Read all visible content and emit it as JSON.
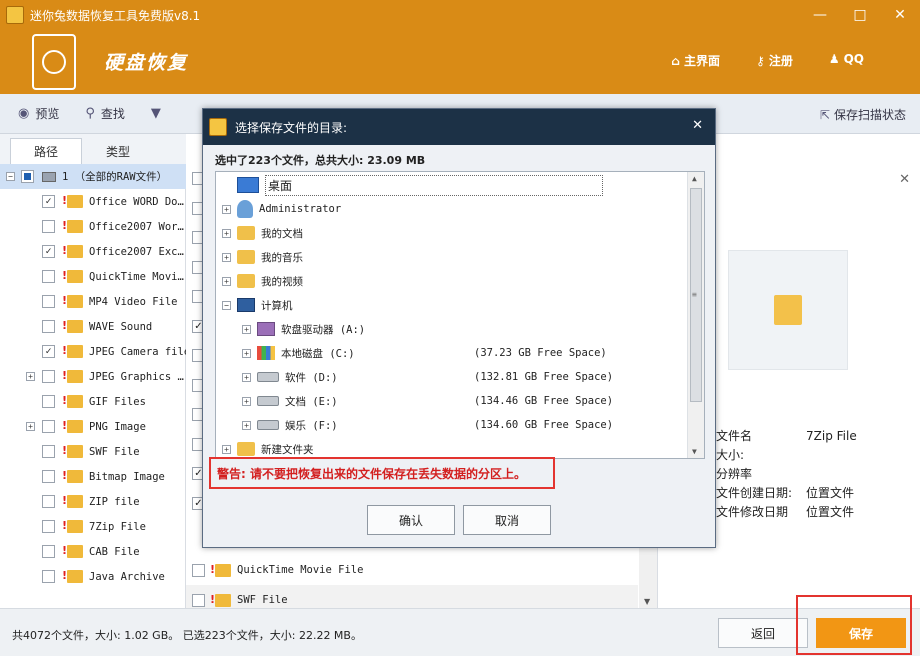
{
  "window": {
    "title": "迷你兔数据恢复工具免费版v8.1",
    "controls": [
      "—",
      "□",
      "✕"
    ]
  },
  "header": {
    "brand": "硬盘恢复",
    "nav": [
      {
        "icon": "home-icon",
        "glyph": "⌂",
        "label": "主界面"
      },
      {
        "icon": "key-icon",
        "glyph": "⚷",
        "label": "注册"
      },
      {
        "icon": "qq-icon",
        "glyph": "♟",
        "label": "QQ"
      }
    ]
  },
  "toolbar": {
    "preview_label": "预览",
    "search_label": "查找",
    "save_scan_label": "保存扫描状态"
  },
  "tabs": [
    "路径",
    "类型"
  ],
  "tree": {
    "root_label": "1 （全部的RAW文件）",
    "items": [
      {
        "label": "Office WORD Do…",
        "checked": true
      },
      {
        "label": "Office2007 Wor…",
        "checked": false
      },
      {
        "label": "Office2007 Exc…",
        "checked": true
      },
      {
        "label": "QuickTime Movi…",
        "checked": false
      },
      {
        "label": "MP4 Video File",
        "checked": false
      },
      {
        "label": "WAVE Sound",
        "checked": false
      },
      {
        "label": "JPEG Camera file",
        "checked": true
      },
      {
        "label": "JPEG Graphics …",
        "checked": false,
        "expandable": true
      },
      {
        "label": "GIF Files",
        "checked": false
      },
      {
        "label": "PNG Image",
        "checked": false,
        "expandable": true
      },
      {
        "label": "SWF File",
        "checked": false
      },
      {
        "label": "Bitmap Image",
        "checked": false
      },
      {
        "label": "ZIP file",
        "checked": false
      },
      {
        "label": "7Zip File",
        "checked": false
      },
      {
        "label": "CAB File",
        "checked": false
      },
      {
        "label": "Java Archive",
        "checked": false
      }
    ]
  },
  "list": {
    "visible_rows": [
      {
        "label": "QuickTime Movie File"
      },
      {
        "label": "SWF File"
      }
    ],
    "left_checks": [
      false,
      false,
      false,
      false,
      false,
      true,
      false,
      false,
      false,
      false,
      true,
      true
    ]
  },
  "preview": {
    "props": [
      {
        "k": "文件名",
        "v": "7Zip File"
      },
      {
        "k": "大小:",
        "v": ""
      },
      {
        "k": "分辨率",
        "v": ""
      },
      {
        "k": "文件创建日期:",
        "v": "位置文件"
      },
      {
        "k": "文件修改日期",
        "v": "位置文件"
      }
    ]
  },
  "status": {
    "text": "共4072个文件，大小: 1.02 GB。 已选223个文件，大小: 22.22 MB。",
    "back_label": "返回",
    "save_label": "保存"
  },
  "dialog": {
    "title": "选择保存文件的目录:",
    "close": "✕",
    "summary": "选中了223个文件，总共大小: 23.09 MB",
    "nodes": [
      {
        "label": "桌面",
        "icon": "desktop-icon"
      },
      {
        "label": "Administrator",
        "icon": "user-icon"
      },
      {
        "label": "我的文档",
        "icon": "folder-icon"
      },
      {
        "label": "我的音乐",
        "icon": "folder-icon"
      },
      {
        "label": "我的视频",
        "icon": "folder-icon"
      },
      {
        "label": "计算机",
        "icon": "computer-icon"
      },
      {
        "label": "软盘驱动器 (A:)",
        "icon": "floppy-icon",
        "free": ""
      },
      {
        "label": "本地磁盘 (C:)",
        "icon": "windows-drive-icon",
        "free": "(37.23 GB Free Space)"
      },
      {
        "label": "软件 (D:)",
        "icon": "drive-icon",
        "free": "(132.81 GB Free Space)"
      },
      {
        "label": "文档 (E:)",
        "icon": "drive-icon",
        "free": "(134.46 GB Free Space)"
      },
      {
        "label": "娱乐 (F:)",
        "icon": "drive-icon",
        "free": "(134.60 GB Free Space)"
      },
      {
        "label": "新建文件夹",
        "icon": "folder-icon"
      }
    ],
    "warning": "警告: 请不要把恢复出来的文件保存在丢失数据的分区上。",
    "ok_label": "确认",
    "cancel_label": "取消"
  },
  "colors": {
    "brand": "#d98b16",
    "save_button": "#f29614",
    "dialog_title": "#1c3146",
    "warning": "#e3342f"
  }
}
